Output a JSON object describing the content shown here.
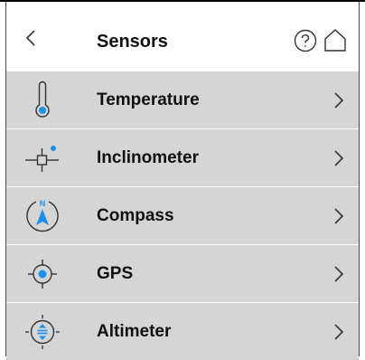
{
  "header": {
    "title": "Sensors",
    "back_icon": "chevron-left-icon",
    "help_icon": "help-circle-icon",
    "home_icon": "home-icon"
  },
  "sensors": [
    {
      "label": "Temperature",
      "icon": "thermometer-icon"
    },
    {
      "label": "Inclinometer",
      "icon": "inclinometer-icon"
    },
    {
      "label": "Compass",
      "icon": "compass-icon"
    },
    {
      "label": "GPS",
      "icon": "gps-icon"
    },
    {
      "label": "Altimeter",
      "icon": "altimeter-icon"
    }
  ],
  "colors": {
    "accent": "#1e90e8",
    "row_background": "#d5d5d5",
    "icon_stroke": "#333333"
  }
}
